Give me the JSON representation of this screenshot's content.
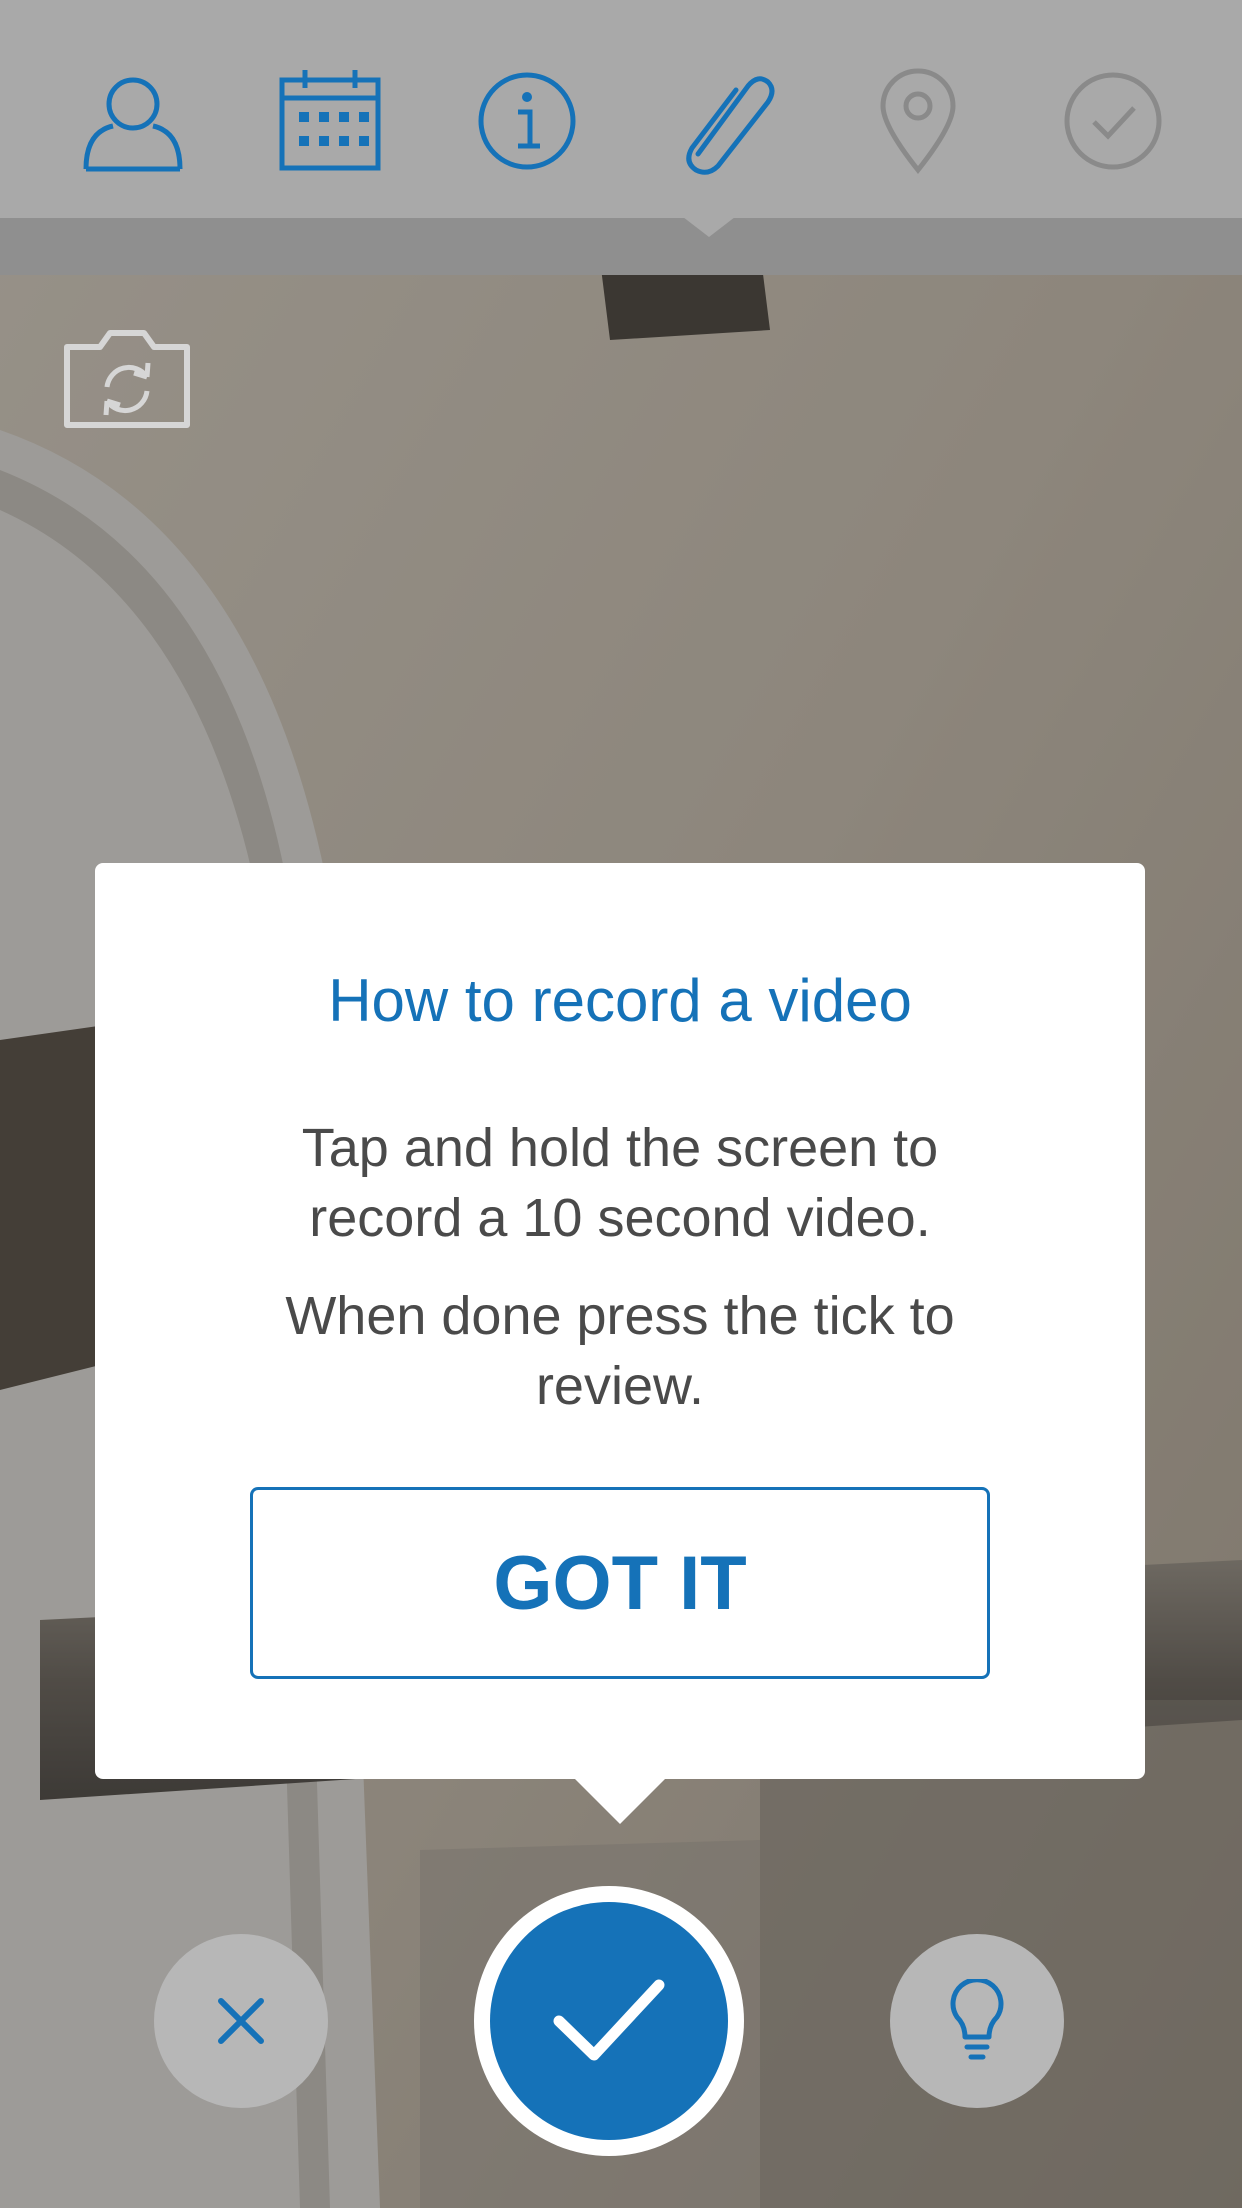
{
  "colors": {
    "accent": "#1572b8",
    "step_bar": "#a9a9a9",
    "step_inactive": "#8a8a8a",
    "card": "#ffffff",
    "body_text": "#4a4a4a",
    "round_button": "#b7b7b7"
  },
  "steps": [
    {
      "icon": "person-icon",
      "state": "complete"
    },
    {
      "icon": "calendar-icon",
      "state": "complete"
    },
    {
      "icon": "info-icon",
      "state": "complete"
    },
    {
      "icon": "paperclip-icon",
      "state": "current"
    },
    {
      "icon": "location-pin-icon",
      "state": "pending"
    },
    {
      "icon": "check-circle-icon",
      "state": "pending"
    }
  ],
  "camera": {
    "flip_icon": "flip-camera-icon"
  },
  "tooltip": {
    "title": "How to record a video",
    "body_line1": "Tap and hold the screen to record a 10 second video.",
    "body_line2": "When done press the tick to review.",
    "button_label": "GOT IT"
  },
  "controls": {
    "cancel_icon": "close-icon",
    "confirm_icon": "checkmark-icon",
    "tips_icon": "lightbulb-icon"
  }
}
